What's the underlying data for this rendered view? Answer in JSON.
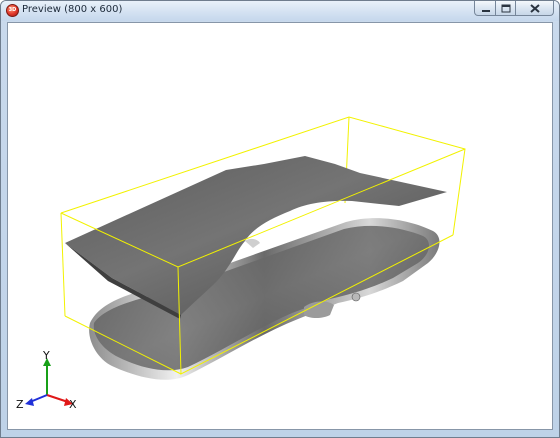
{
  "window": {
    "title": "Preview (800 x 600)",
    "icon": "app-3d-icon",
    "icon_text": "3D",
    "controls": {
      "minimize": "minimize-icon",
      "maximize": "maximize-icon",
      "close": "close-icon"
    }
  },
  "viewport": {
    "background": "#ffffff",
    "bounding_box_color": "#f2f200",
    "surface_color": "#6a6a6a"
  },
  "axes": {
    "x": {
      "label": "X",
      "color": "#e01818"
    },
    "y": {
      "label": "Y",
      "color": "#18a018"
    },
    "z": {
      "label": "Z",
      "color": "#2030d8"
    }
  }
}
